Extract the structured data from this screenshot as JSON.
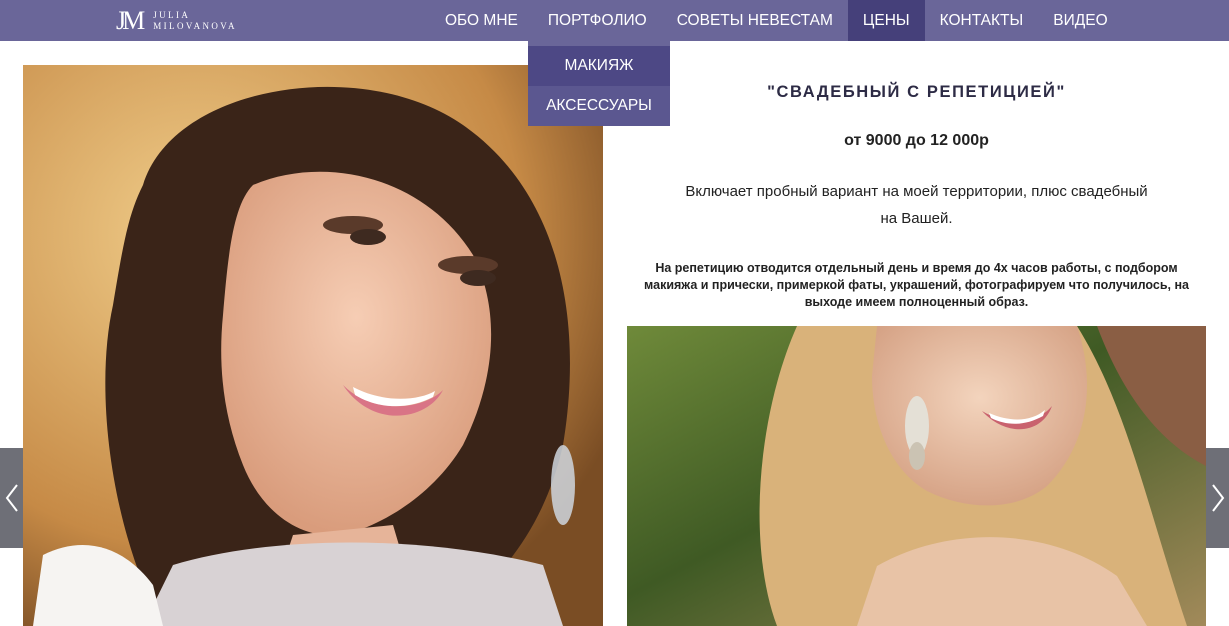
{
  "logo": {
    "mark": "JM",
    "line1": "JULIA",
    "line2": "MILOVANOVA"
  },
  "nav": {
    "items": [
      {
        "label": "ОБО МНЕ"
      },
      {
        "label": "ПОРТФОЛИО"
      },
      {
        "label": "СОВЕТЫ НЕВЕСТАМ"
      },
      {
        "label": "ЦЕНЫ"
      },
      {
        "label": "КОНТАКТЫ"
      },
      {
        "label": "ВИДЕО"
      }
    ],
    "active": "ЦЕНЫ"
  },
  "dropdown": {
    "items": [
      {
        "label": "МАКИЯЖ"
      },
      {
        "label": "АКСЕССУАРЫ"
      }
    ]
  },
  "content": {
    "title": "\"СВАДЕБНЫЙ С РЕПЕТИЦИЕЙ\"",
    "price": "от 9000 до 12 000р",
    "description": "Включает пробный вариант на моей территории, плюс свадебный на Вашей.",
    "note": "На репетицию отводится отдельный день и время до 4х часов работы, с подбором макияжа и прически, примеркой фаты, украшений, фотографируем что получилось, на выходе имеем полноценный образ."
  },
  "colors": {
    "header": "#6a6699",
    "active_nav": "#45407a",
    "dropdown": "#4d4885",
    "arrow": "#6e6f77"
  },
  "icons": {
    "prev": "chevron-left-icon",
    "next": "chevron-right-icon"
  }
}
